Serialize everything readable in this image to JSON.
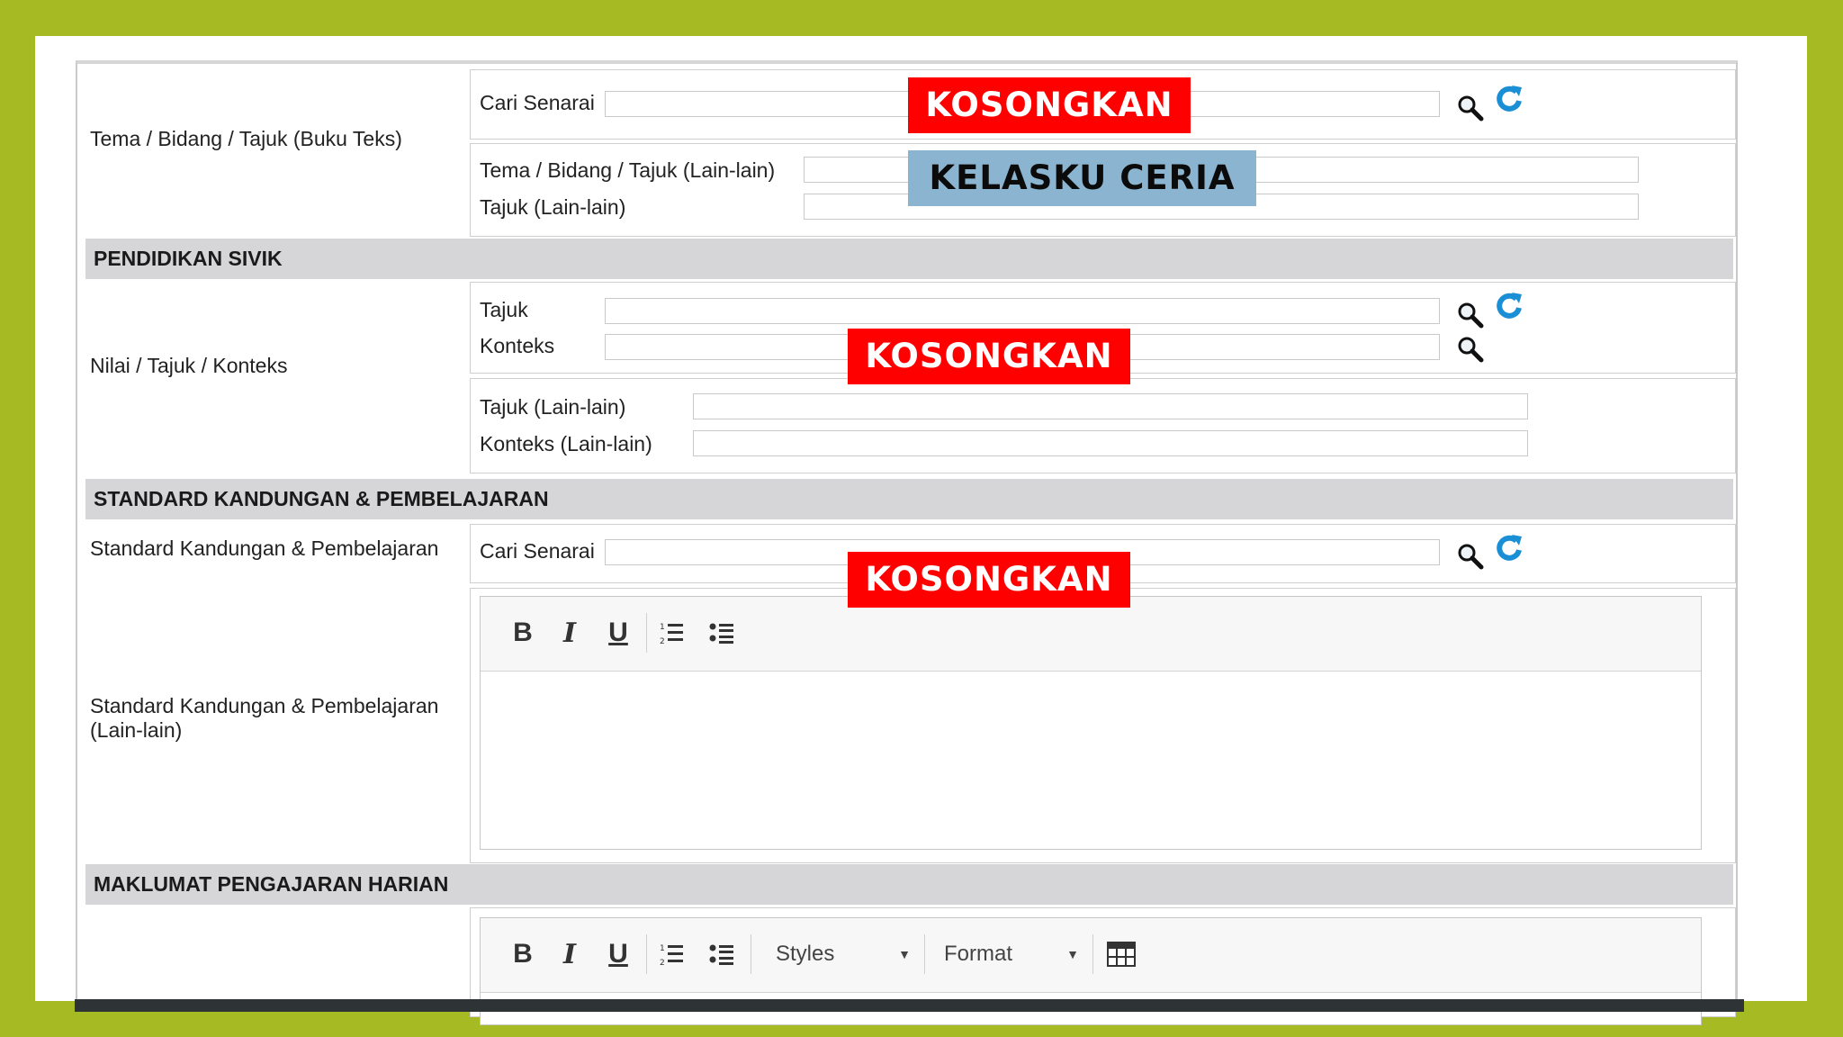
{
  "colors": {
    "outer_background": "#a6ba24",
    "section_background": "#d6d6d8",
    "overlay_red": "#ff0000",
    "overlay_blue": "#8ab4cf",
    "refresh_icon": "#1a8fd6"
  },
  "row1": {
    "label": "Tema / Bidang / Tajuk (Buku Teks)",
    "search_label": "Cari Senarai",
    "search_value": "",
    "other_label": "Tema / Bidang / Tajuk (Lain-lain)",
    "other_value": "",
    "tajuk_other_label": "Tajuk (Lain-lain)",
    "tajuk_other_value": ""
  },
  "section_sivik": {
    "title": "PENDIDIKAN SIVIK"
  },
  "row2": {
    "label": "Nilai / Tajuk / Konteks",
    "tajuk_label": "Tajuk",
    "konteks_label": "Konteks",
    "tajuk_other_label": "Tajuk (Lain-lain)",
    "konteks_other_label": "Konteks (Lain-lain)"
  },
  "section_standard": {
    "title": "STANDARD KANDUNGAN & PEMBELAJARAN"
  },
  "row3": {
    "label": "Standard Kandungan & Pembelajaran",
    "search_label": "Cari Senarai",
    "other_label": "Standard Kandungan & Pembelajaran (Lain-lain)"
  },
  "section_maklumat": {
    "title": "MAKLUMAT PENGAJARAN HARIAN"
  },
  "editor": {
    "bold": "B",
    "italic": "I",
    "underline": "U",
    "styles_label": "Styles",
    "format_label": "Format"
  },
  "overlays": {
    "kosongkan_1": "KOSONGKAN",
    "kelasku": "KELASKU CERIA",
    "kosongkan_2": "KOSONGKAN",
    "kosongkan_3": "KOSONGKAN"
  }
}
